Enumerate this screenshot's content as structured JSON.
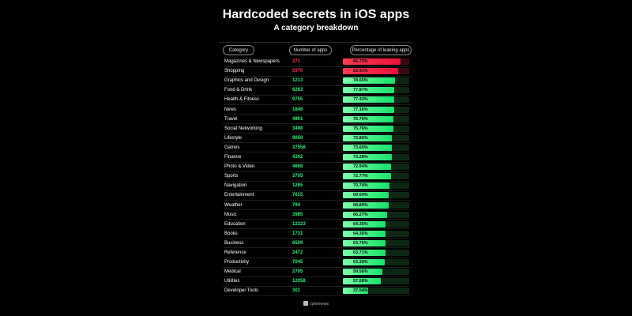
{
  "title": "Hardcoded secrets in iOS apps",
  "subtitle": "A category breakdown",
  "brand": "cybernews",
  "colors": {
    "background": "#000000",
    "high_bar": "#e8123e",
    "high_text": "#ff2e4a",
    "green_bar": "#16e36a",
    "green_text": "#2ef07a"
  },
  "chart_data": {
    "type": "table",
    "columns": [
      "Category",
      "Number of apps",
      "Percentage of leaking apps"
    ],
    "rows": [
      {
        "category": "Magazines & Newspapers",
        "apps": "271",
        "pct": "86.72%",
        "value": 86.72
      },
      {
        "category": "Shopping",
        "apps": "5970",
        "pct": "83.91%",
        "value": 83.91
      },
      {
        "category": "Graphics and Design",
        "apps": "1213",
        "pct": "78.65%",
        "value": 78.65
      },
      {
        "category": "Food & Drink",
        "apps": "6263",
        "pct": "77.87%",
        "value": 77.87
      },
      {
        "category": "Health & Fitness",
        "apps": "9755",
        "pct": "77.43%",
        "value": 77.43
      },
      {
        "category": "News",
        "apps": "1848",
        "pct": "77.16%",
        "value": 77.16
      },
      {
        "category": "Travel",
        "apps": "4901",
        "pct": "76.76%",
        "value": 76.76
      },
      {
        "category": "Social Networking",
        "apps": "3498",
        "pct": "75.76%",
        "value": 75.76
      },
      {
        "category": "Lifestyle",
        "apps": "9856",
        "pct": "73.80%",
        "value": 73.8
      },
      {
        "category": "Games",
        "apps": "37558",
        "pct": "73.66%",
        "value": 73.66
      },
      {
        "category": "Finance",
        "apps": "4302",
        "pct": "73.28%",
        "value": 73.28
      },
      {
        "category": "Photo & Video",
        "apps": "4668",
        "pct": "72.94%",
        "value": 72.94
      },
      {
        "category": "Sports",
        "apps": "3705",
        "pct": "72.77%",
        "value": 72.77
      },
      {
        "category": "Navigation",
        "apps": "1285",
        "pct": "70.74%",
        "value": 70.74
      },
      {
        "category": "Entertainment",
        "apps": "7615",
        "pct": "69.00%",
        "value": 69.0
      },
      {
        "category": "Weather",
        "apps": "794",
        "pct": "68.89%",
        "value": 68.89
      },
      {
        "category": "Music",
        "apps": "3985",
        "pct": "66.27%",
        "value": 66.27
      },
      {
        "category": "Education",
        "apps": "12323",
        "pct": "64.36%",
        "value": 64.36
      },
      {
        "category": "Books",
        "apps": "1731",
        "pct": "64.36%",
        "value": 64.36
      },
      {
        "category": "Business",
        "apps": "6509",
        "pct": "63.76%",
        "value": 63.76
      },
      {
        "category": "Reference",
        "apps": "2472",
        "pct": "63.71%",
        "value": 63.71
      },
      {
        "category": "Productivity",
        "apps": "7045",
        "pct": "63.39%",
        "value": 63.39
      },
      {
        "category": "Medical",
        "apps": "2705",
        "pct": "59.56%",
        "value": 59.56
      },
      {
        "category": "Utilities",
        "apps": "12058",
        "pct": "57.58%",
        "value": 57.58
      },
      {
        "category": "Developer Tools",
        "apps": "301",
        "pct": "37.54%",
        "value": 37.54
      }
    ]
  }
}
